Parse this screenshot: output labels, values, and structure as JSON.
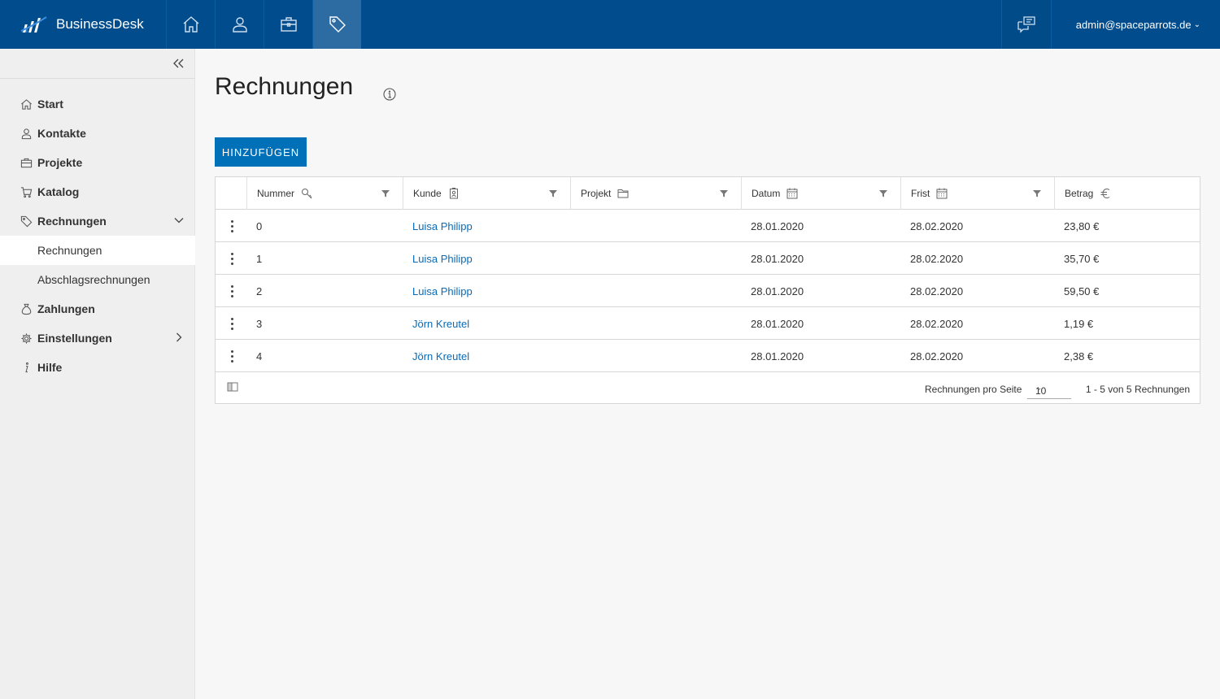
{
  "app": {
    "name": "BusinessDesk"
  },
  "topnav": {
    "items": [
      {
        "icon": "home-icon"
      },
      {
        "icon": "user-icon"
      },
      {
        "icon": "briefcase-icon"
      },
      {
        "icon": "tag-icon",
        "active": true
      }
    ],
    "chat_icon": "chat-icon",
    "user": "admin@spaceparrots.de"
  },
  "sidebar": {
    "items": [
      {
        "label": "Start",
        "icon": "home-icon"
      },
      {
        "label": "Kontakte",
        "icon": "user-icon"
      },
      {
        "label": "Projekte",
        "icon": "briefcase-icon"
      },
      {
        "label": "Katalog",
        "icon": "cart-icon"
      },
      {
        "label": "Rechnungen",
        "icon": "tag-icon",
        "expanded": true
      },
      {
        "label": "Zahlungen",
        "icon": "money-bag-icon"
      },
      {
        "label": "Einstellungen",
        "icon": "gear-icon"
      },
      {
        "label": "Hilfe",
        "icon": "info-icon"
      }
    ],
    "subitems": [
      {
        "label": "Rechnungen",
        "active": true
      },
      {
        "label": "Abschlagsrechnungen"
      }
    ]
  },
  "page": {
    "title": "Rechnungen",
    "add_label": "HINZUFÜGEN"
  },
  "table": {
    "columns": [
      {
        "label": "Nummer",
        "icon": "key-icon"
      },
      {
        "label": "Kunde",
        "icon": "contact-card-icon"
      },
      {
        "label": "Projekt",
        "icon": "folder-icon"
      },
      {
        "label": "Datum",
        "icon": "calendar-icon"
      },
      {
        "label": "Frist",
        "icon": "calendar-icon"
      },
      {
        "label": "Betrag",
        "icon": "euro-icon"
      }
    ],
    "rows": [
      {
        "nummer": "0",
        "kunde": "Luisa Philipp",
        "projekt": "",
        "datum": "28.01.2020",
        "frist": "28.02.2020",
        "betrag": "23,80 €"
      },
      {
        "nummer": "1",
        "kunde": "Luisa Philipp",
        "projekt": "",
        "datum": "28.01.2020",
        "frist": "28.02.2020",
        "betrag": "35,70 €"
      },
      {
        "nummer": "2",
        "kunde": "Luisa Philipp",
        "projekt": "",
        "datum": "28.01.2020",
        "frist": "28.02.2020",
        "betrag": "59,50 €"
      },
      {
        "nummer": "3",
        "kunde": "Jörn Kreutel",
        "projekt": "",
        "datum": "28.01.2020",
        "frist": "28.02.2020",
        "betrag": "1,19 €"
      },
      {
        "nummer": "4",
        "kunde": "Jörn Kreutel",
        "projekt": "",
        "datum": "28.01.2020",
        "frist": "28.02.2020",
        "betrag": "2,38 €"
      }
    ],
    "footer": {
      "per_page_label": "Rechnungen pro Seite",
      "per_page_value": "10",
      "range": "1 - 5 von 5 Rechnungen"
    }
  },
  "colors": {
    "topbar": "#004c8c",
    "accent": "#0070b8",
    "link": "#0a6ab4"
  }
}
